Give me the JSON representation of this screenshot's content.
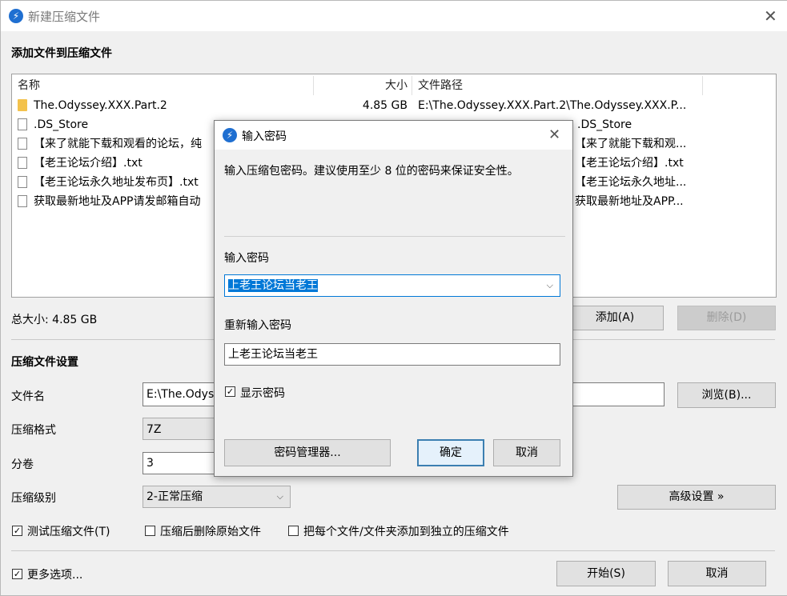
{
  "window": {
    "title": "新建压缩文件"
  },
  "main": {
    "add_files_title": "添加文件到压缩文件",
    "columns": {
      "name": "名称",
      "size": "大小",
      "path": "文件路径"
    },
    "files": [
      {
        "icon": "folder-icon",
        "name": "The.Odyssey.XXX.Part.2",
        "size": "4.85 GB",
        "path": "E:\\The.Odyssey.XXX.Part.2\\The.Odyssey.XXX.P..."
      },
      {
        "icon": "file-icon",
        "name": ".DS_Store",
        "size": "",
        "path": ".DS_Store"
      },
      {
        "icon": "file-icon",
        "name": "【来了就能下载和观看的论坛，纯",
        "size": "",
        "path": "【来了就能下载和观..."
      },
      {
        "icon": "file-icon",
        "name": "【老王论坛介绍】.txt",
        "size": "",
        "path": "【老王论坛介绍】.txt"
      },
      {
        "icon": "file-icon",
        "name": "【老王论坛永久地址发布页】.txt",
        "size": "",
        "path": "【老王论坛永久地址..."
      },
      {
        "icon": "file-icon",
        "name": "获取最新地址及APP请发邮箱自动",
        "size": "",
        "path": "获取最新地址及APP..."
      }
    ],
    "total_size": "总大小: 4.85 GB",
    "add_button": "添加(A)",
    "delete_button": "删除(D)",
    "settings_title": "压缩文件设置",
    "filename_label": "文件名",
    "filename_value": "E:\\The.Odys",
    "browse_button": "浏览(B)...",
    "format_label": "压缩格式",
    "format_value": "7Z",
    "volume_label": "分卷",
    "volume_value": "3",
    "level_label": "压缩级别",
    "level_value": "2-正常压缩",
    "advanced_button": "高级设置 »",
    "test_archive": "测试压缩文件(T)",
    "delete_after": "压缩后删除原始文件",
    "separate_archives": "把每个文件/文件夹添加到独立的压缩文件",
    "more_options": "更多选项...",
    "start_button": "开始(S)",
    "cancel_button": "取消"
  },
  "dialog": {
    "title": "输入密码",
    "hint": "输入压缩包密码。建议使用至少 8 位的密码来保证安全性。",
    "password_label": "输入密码",
    "password_value": "上老王论坛当老王",
    "confirm_label": "重新输入密码",
    "confirm_value": "上老王论坛当老王",
    "show_password": "显示密码",
    "manager_button": "密码管理器...",
    "ok_button": "确定",
    "cancel_button": "取消"
  }
}
